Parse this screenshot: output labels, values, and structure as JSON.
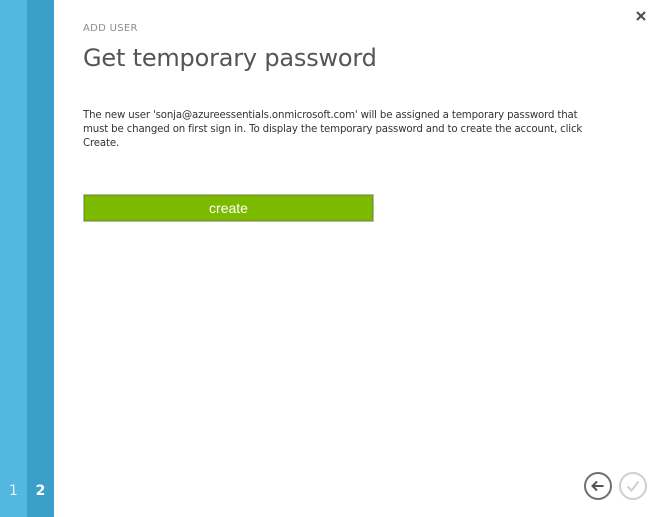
{
  "wizard": {
    "steps": [
      {
        "label": "1"
      },
      {
        "label": "2"
      }
    ],
    "eyebrow": "ADD USER",
    "title": "Get temporary password",
    "description": "The new user 'sonja@azureessentials.onmicrosoft.com' will be assigned a temporary password that must be changed on first sign in. To display the temporary password and to create the account, click Create.",
    "create_button_label": "create"
  },
  "icons": {
    "close": "close-icon",
    "back": "back-arrow-icon",
    "finish": "checkmark-icon"
  },
  "colors": {
    "step1_rail": "#54b7e0",
    "step2_rail": "#3aa0c9",
    "create_button": "#7cba00",
    "title_text": "#555555"
  }
}
